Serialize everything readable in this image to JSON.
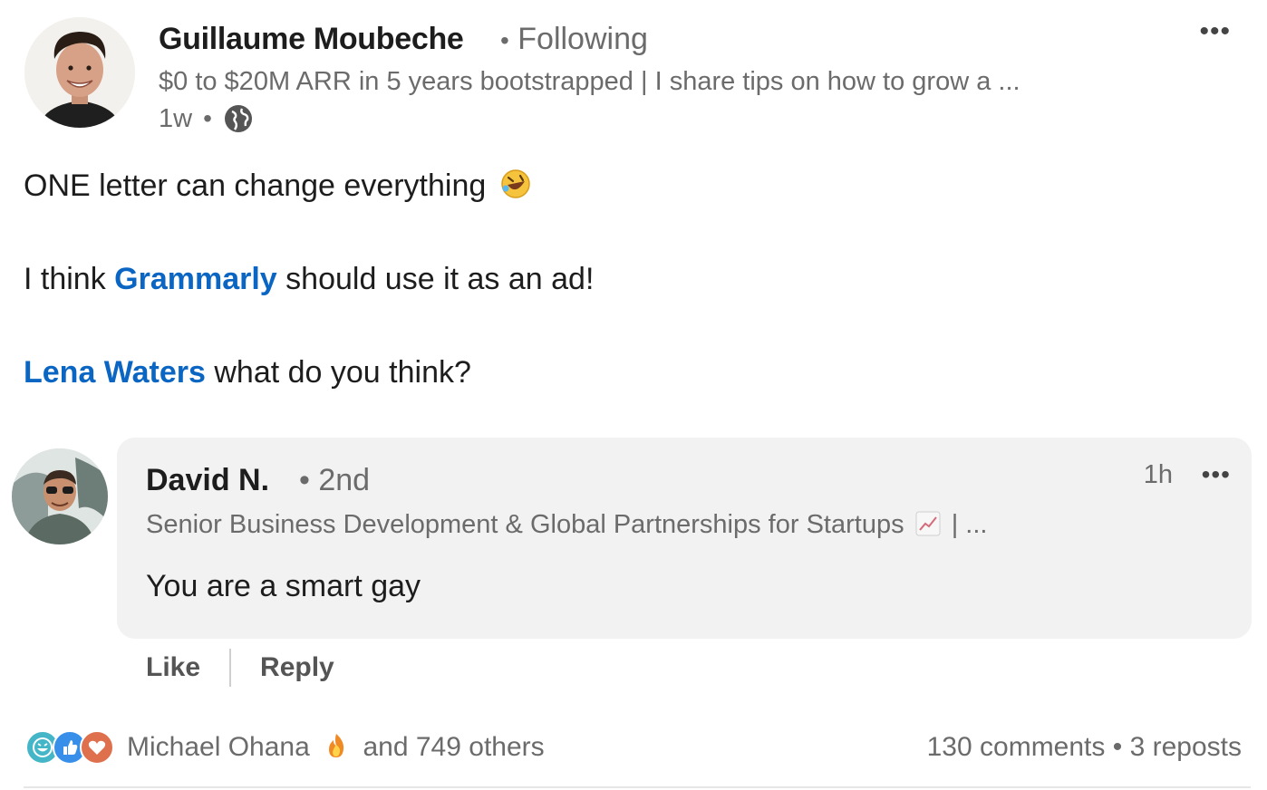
{
  "post": {
    "author_name": "Guillaume Moubeche",
    "follow_status": "Following",
    "separator": "•",
    "headline": "$0 to $20M ARR in 5 years bootstrapped | I share tips on how to grow a ...",
    "time": "1w",
    "visibility_icon": "globe-icon",
    "more_icon": "•••",
    "line1": "ONE letter can change everything",
    "line1_emoji": "rolling-on-floor-laughing-emoji",
    "line2_prefix": "I think ",
    "line2_link": "Grammarly",
    "line2_suffix": " should use it as an ad!",
    "line3_link": "Lena Waters",
    "line3_suffix": " what do you think?"
  },
  "comment": {
    "author_name": "David N.",
    "degree": "• 2nd",
    "headline_before": "Senior Business Development & Global Partnerships for Startups",
    "headline_after": "| ...",
    "headline_icon": "chart-increasing-icon",
    "time": "1h",
    "more_icon": "•••",
    "text": "You are a smart gay",
    "like_label": "Like",
    "reply_label": "Reply"
  },
  "footer": {
    "reaction_icons": [
      "laugh-icon",
      "like-icon",
      "love-icon"
    ],
    "reactor_name": "Michael Ohana",
    "reactor_emoji": "fire-emoji",
    "others": "and 749 others",
    "comments": "130 comments",
    "sep": "•",
    "reposts": "3 reposts"
  },
  "colors": {
    "link": "#0a66c2",
    "muted": "#6b6b6b",
    "comment_bg": "#f2f2f2",
    "like_blue": "#378fe9",
    "love_red": "#df704d",
    "laugh_teal": "#44b6c7"
  }
}
